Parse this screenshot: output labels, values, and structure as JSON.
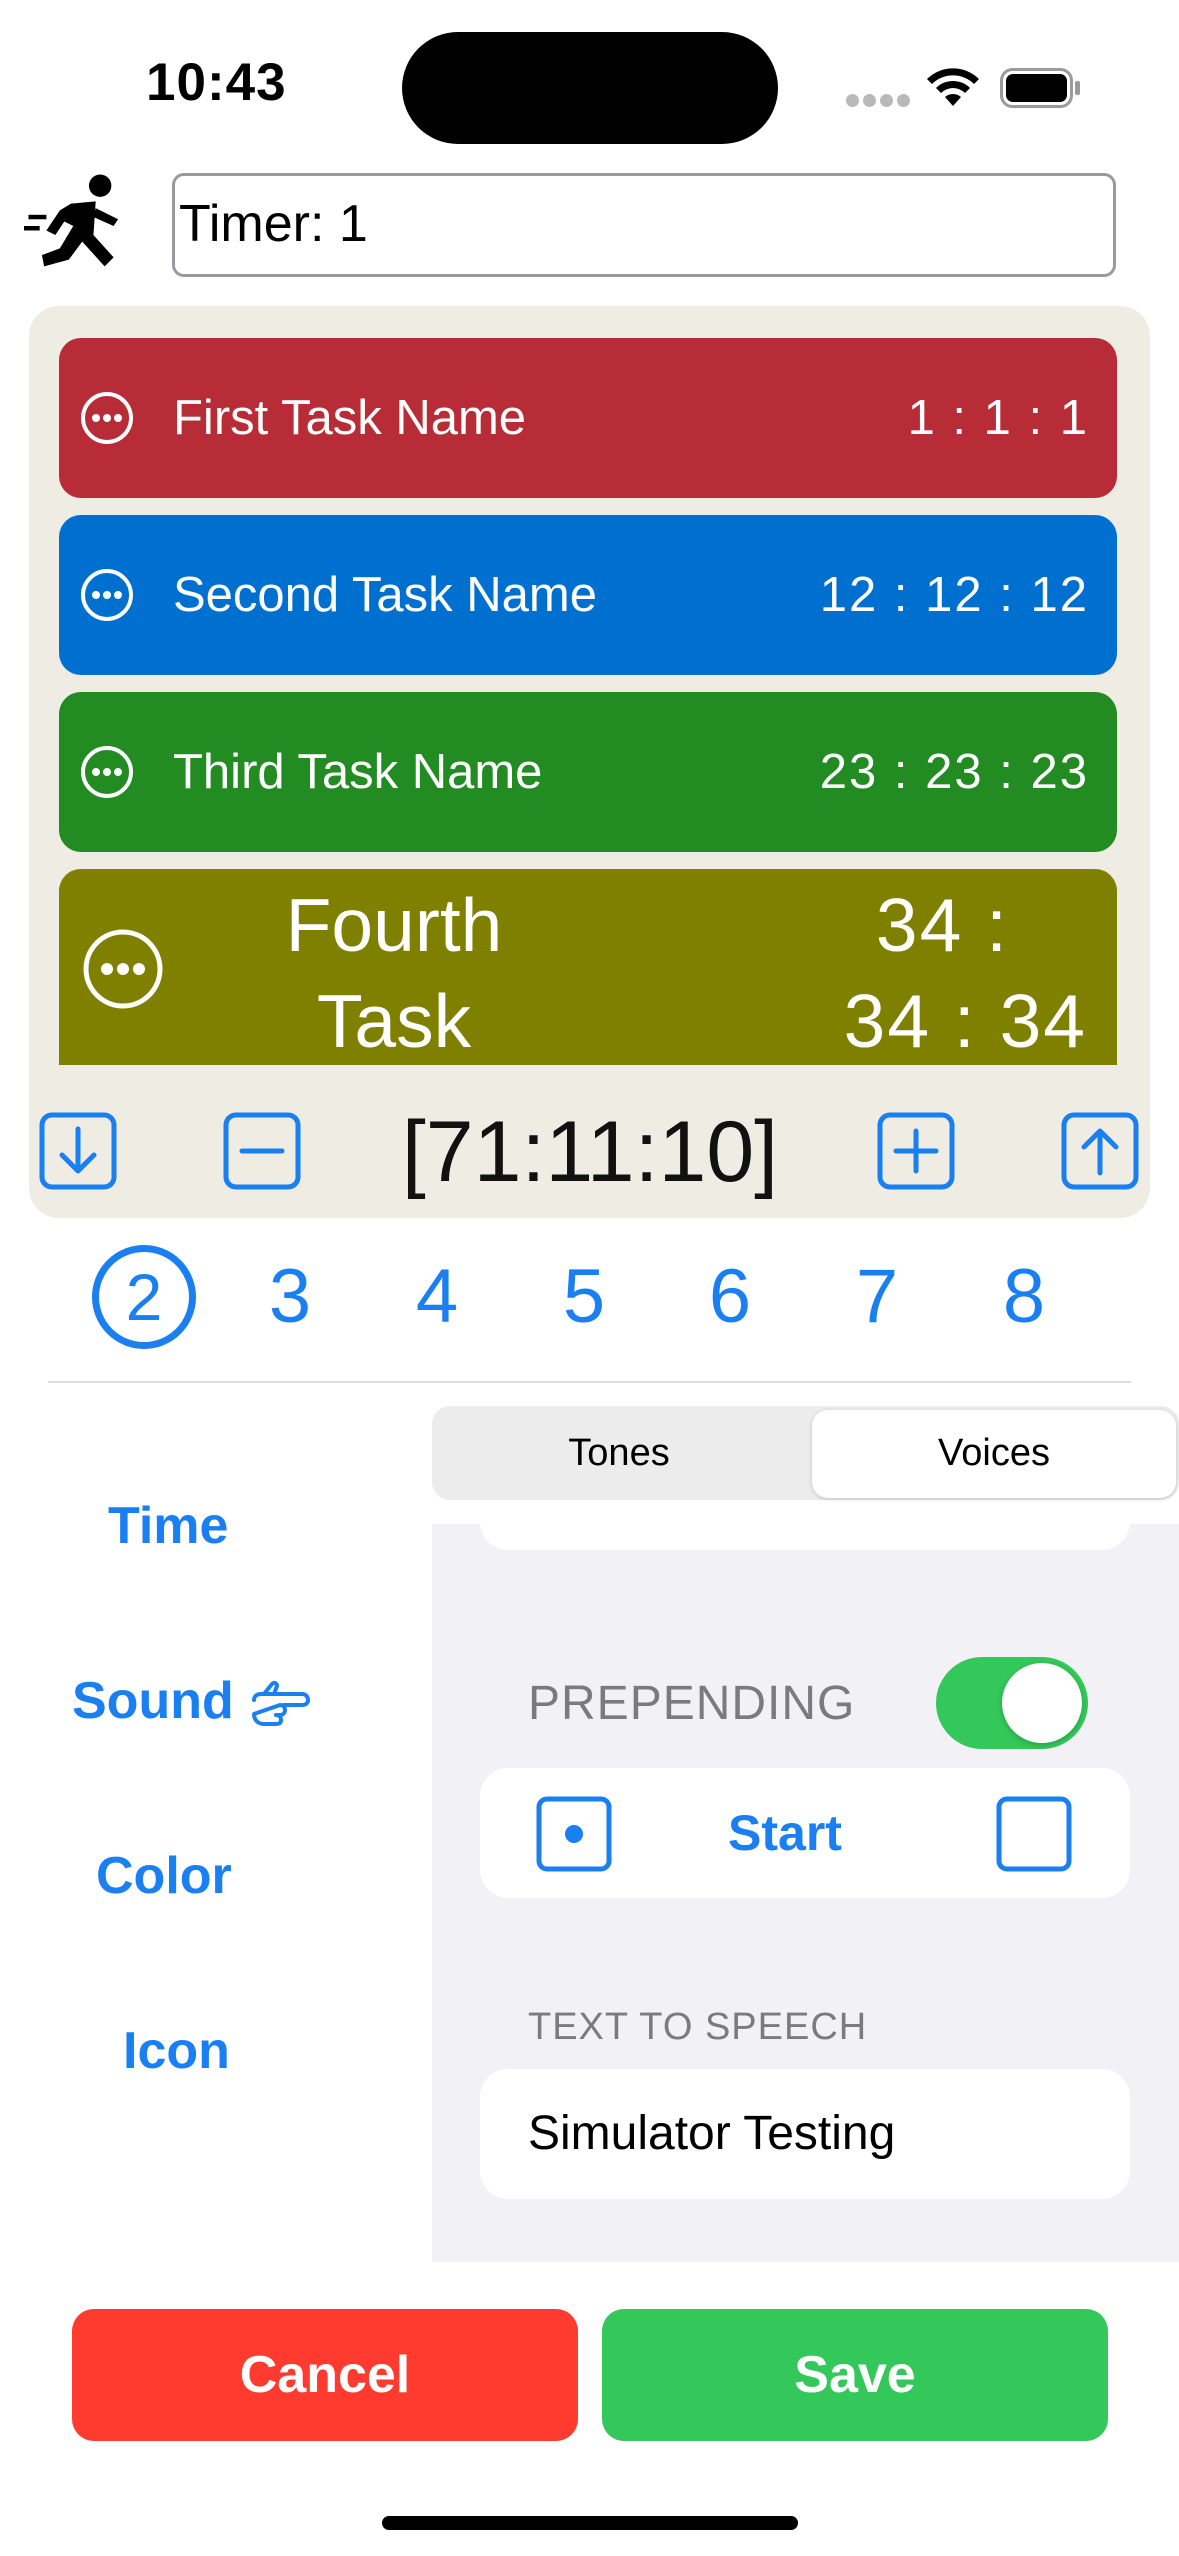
{
  "status_bar": {
    "time": "10:43"
  },
  "header": {
    "timer_name_value": "Timer: 1",
    "runner_icon": "runner-icon"
  },
  "tasks": [
    {
      "name": "First Task Name",
      "duration": "1 : 1 : 1",
      "color": "#b72c37"
    },
    {
      "name": "Second Task Name",
      "duration": "12 : 12 : 12",
      "color": "#0070d0"
    },
    {
      "name": "Third Task Name",
      "duration": "23 : 23 : 23",
      "color": "#228b22"
    },
    {
      "name_line1": "Fourth",
      "name_line2": "Task Name",
      "duration_line1": "34 :",
      "duration_line2": "34 : 34",
      "color": "#808000"
    }
  ],
  "controls": {
    "total": "[71:11:10]",
    "move_down_icon": "arrow-down-square-icon",
    "remove_icon": "minus-square-icon",
    "add_icon": "plus-square-icon",
    "move_up_icon": "arrow-up-square-icon"
  },
  "number_picker": {
    "selected": "2",
    "options": [
      "2",
      "3",
      "4",
      "5",
      "6",
      "7",
      "8"
    ]
  },
  "side_menu": {
    "time": "Time",
    "sound": "Sound",
    "color": "Color",
    "icon": "Icon",
    "pointer_icon": "hand-point-right-icon"
  },
  "segmented": {
    "tones": "Tones",
    "voices": "Voices",
    "selected": "Voices"
  },
  "voice_settings": {
    "prepending_label": "PREPENDING",
    "prepending_on": true,
    "start_label": "Start",
    "text_to_speech_header": "TEXT TO SPEECH",
    "text_to_speech_value": "Simulator Testing"
  },
  "footer": {
    "cancel": "Cancel",
    "save": "Save"
  },
  "colors": {
    "accent": "#1a7ff0",
    "cancel": "#ff3b30",
    "save": "#34c759",
    "toggle_on": "#34c759",
    "panel_bg": "#efece4"
  }
}
